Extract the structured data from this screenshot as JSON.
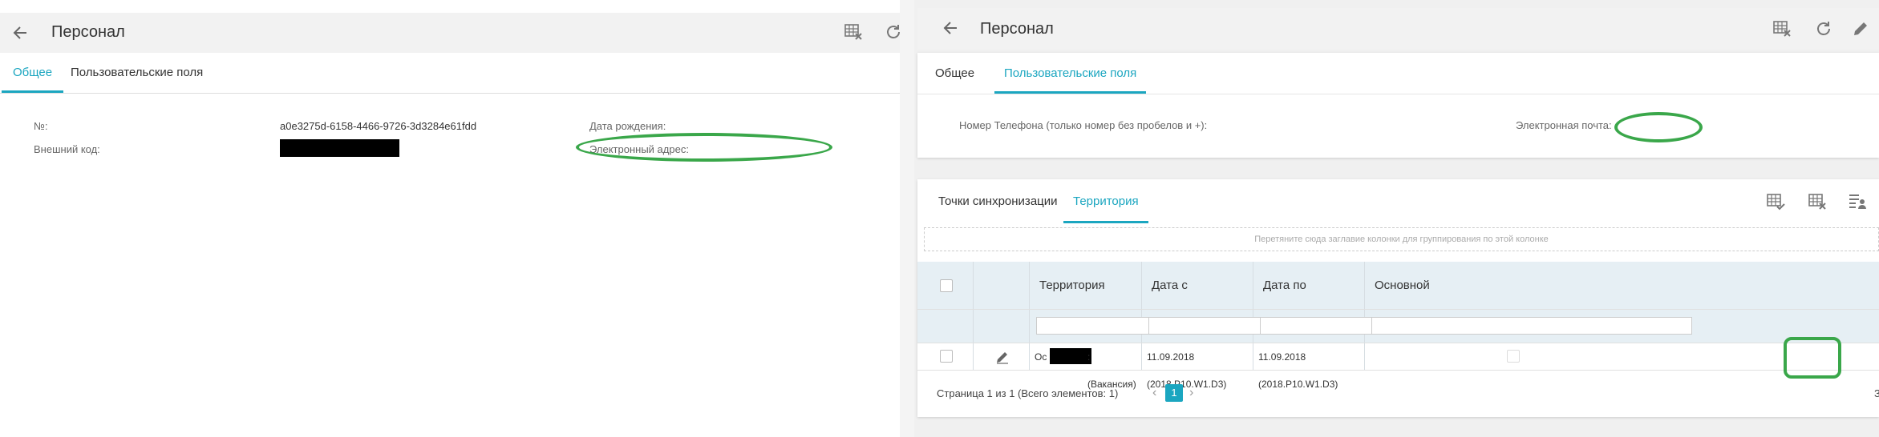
{
  "left": {
    "title": "Персонал",
    "tabs": [
      {
        "label": "Общее",
        "active": true
      },
      {
        "label": "Пользовательские поля",
        "active": false
      }
    ],
    "fields": {
      "number_label": "№:",
      "number_value": "a0e3275d-6158-4466-9726-3d3284e61fdd",
      "external_code_label": "Внешний код:",
      "birth_date_label": "Дата рождения:",
      "email_label": "Электронный адрес:"
    },
    "icons": [
      "back-arrow-icon",
      "grid-clear-icon",
      "refresh-icon"
    ]
  },
  "right": {
    "title": "Персонал",
    "top_tabs": [
      {
        "label": "Общее",
        "active": false
      },
      {
        "label": "Пользовательские поля",
        "active": true
      }
    ],
    "custom_fields": {
      "phone_label": "Номер Телефона (только номер без пробелов и +):",
      "email_label": "Электронная почта:"
    },
    "grid_tabs": [
      {
        "label": "Точки синхронизации",
        "active": false
      },
      {
        "label": "Территория",
        "active": true
      }
    ],
    "group_hint": "Перетяните сюда заглавие колонки для группирования по этой колонке",
    "columns": [
      "Территория",
      "Дата с",
      "Дата по",
      "Основной"
    ],
    "row": {
      "territory_prefix": "Ос",
      "territory_suffix": ": (Вакансия)",
      "date_from": "11.09.2018 (2018.P10.W1.D3)",
      "date_to": "11.09.2018 (2018.P10.W1.D3)"
    },
    "pager": {
      "info": "Страница 1 из 1 (Всего элементов: 1)",
      "current_page": "1",
      "trailing": "За"
    },
    "accent": "#1ba6c0",
    "highlight": "#3aa74a"
  }
}
